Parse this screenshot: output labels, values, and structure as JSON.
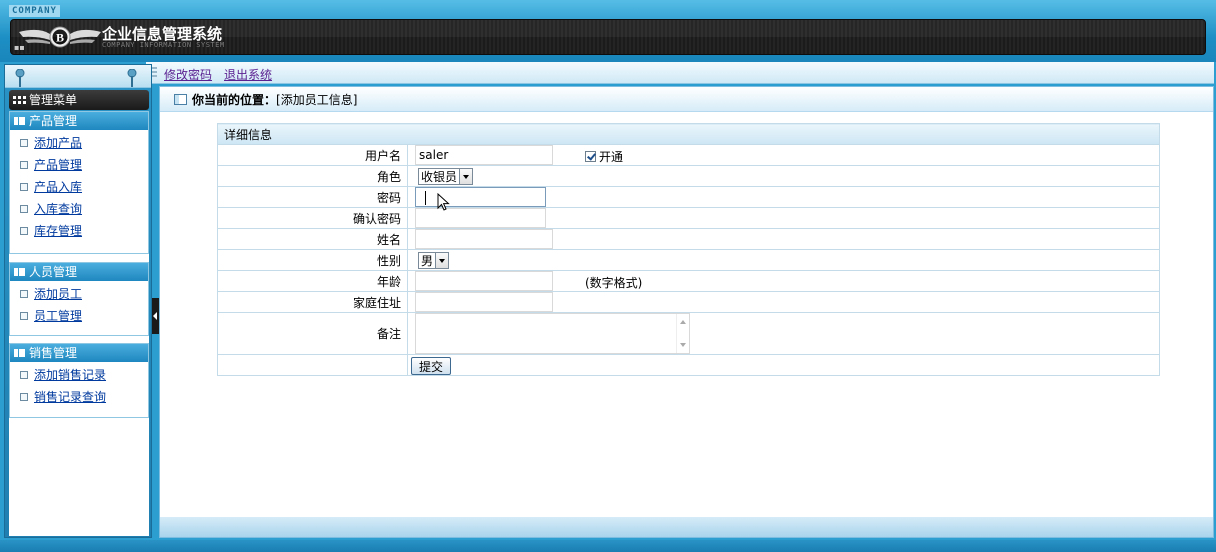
{
  "header": {
    "company_tag": "COMPANY",
    "system_title": "企业信息管理系统",
    "system_subtitle": "COMPANY INFORMATION SYSTEM"
  },
  "topnav": {
    "change_password": "修改密码",
    "logout": "退出系统"
  },
  "sidebar": {
    "menu_title": "管理菜单",
    "groups": [
      {
        "title": "产品管理",
        "items": [
          "添加产品",
          "产品管理",
          "产品入库",
          "入库查询",
          "库存管理"
        ]
      },
      {
        "title": "人员管理",
        "items": [
          "添加员工",
          "员工管理"
        ]
      },
      {
        "title": "销售管理",
        "items": [
          "添加销售记录",
          "销售记录查询"
        ]
      }
    ]
  },
  "breadcrumb": {
    "label": "你当前的位置：",
    "value": "[添加员工信息]"
  },
  "form": {
    "section_title": "详细信息",
    "username_label": "用户名",
    "username_value": "saler",
    "enabled_label": "开通",
    "role_label": "角色",
    "role_value": "收银员",
    "password_label": "密码",
    "confirm_password_label": "确认密码",
    "name_label": "姓名",
    "gender_label": "性别",
    "gender_value": "男",
    "age_label": "年龄",
    "age_hint": "(数字格式)",
    "address_label": "家庭住址",
    "remark_label": "备注",
    "submit_label": "提交"
  },
  "colors": {
    "frame_blue": "#2d9ed0",
    "title_bar_dark": "#1b1b1b",
    "link_blue": "#003a9e",
    "link_purple": "#5b2191"
  }
}
